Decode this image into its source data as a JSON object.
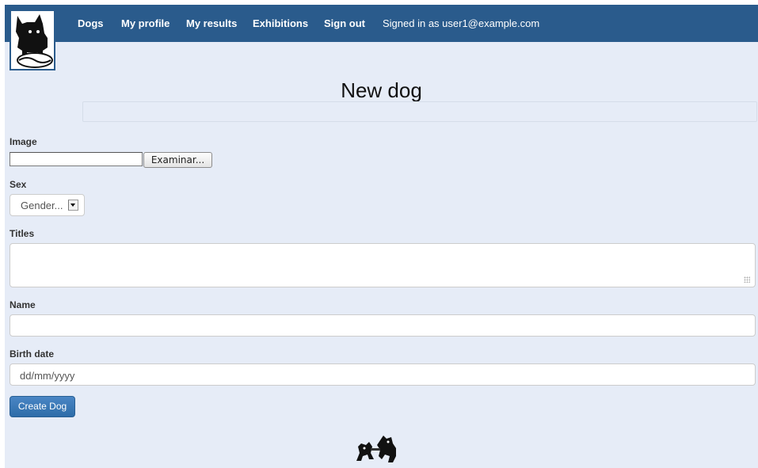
{
  "nav": {
    "items": [
      {
        "label": "Dogs"
      },
      {
        "label": "My profile"
      },
      {
        "label": "My results"
      },
      {
        "label": "Exhibitions"
      },
      {
        "label": "Sign out"
      }
    ],
    "signed_in": "Signed in as user1@example.com"
  },
  "page": {
    "title": "New dog"
  },
  "form": {
    "image_label": "Image",
    "file_button": "Examinar...",
    "sex_label": "Sex",
    "sex_selected": "Gender...",
    "titles_label": "Titles",
    "titles_value": "",
    "name_label": "Name",
    "name_value": "",
    "birth_date_label": "Birth date",
    "birth_date_placeholder": "dd/mm/yyyy",
    "submit_label": "Create Dog"
  },
  "colors": {
    "navbar": "#2a5b8c",
    "background": "#e6ecf7",
    "primary_button": "#3477b6"
  }
}
